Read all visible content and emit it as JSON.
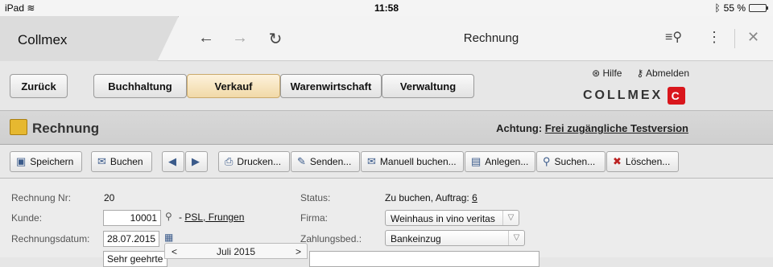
{
  "status_bar": {
    "device": "iPad",
    "wifi_icon": "wifi-icon",
    "time": "11:58",
    "bluetooth_icon": "bluetooth-icon",
    "battery": "55 %",
    "battery_level": 0.55
  },
  "browser": {
    "tab_title": "Collmex",
    "page_title": "Rechnung",
    "back_icon": "arrow-left-icon",
    "forward_icon": "arrow-right-icon",
    "reload_icon": "reload-icon",
    "search_icon": "search-list-icon",
    "menu_icon": "more-vertical-icon",
    "close_icon": "close-icon"
  },
  "app": {
    "back_label": "Zurück",
    "nav": [
      {
        "label": "Buchhaltung",
        "active": false
      },
      {
        "label": "Verkauf",
        "active": true
      },
      {
        "label": "Warenwirtschaft",
        "active": false
      },
      {
        "label": "Verwaltung",
        "active": false
      }
    ],
    "help_label": "Hilfe",
    "logout_label": "Abmelden",
    "logo_text": "COLLMEX"
  },
  "page": {
    "title": "Rechnung",
    "notice_prefix": "Achtung:",
    "notice_link": "Frei zugängliche Testversion"
  },
  "toolbar": [
    {
      "label": "Speichern",
      "icon": "save-icon"
    },
    {
      "label": "Buchen",
      "icon": "post-icon"
    },
    {
      "label": "",
      "icon": "arrow-left-icon"
    },
    {
      "label": "",
      "icon": "arrow-right-icon"
    },
    {
      "label": "Drucken...",
      "icon": "print-icon"
    },
    {
      "label": "Senden...",
      "icon": "send-icon"
    },
    {
      "label": "Manuell buchen...",
      "icon": "manual-post-icon"
    },
    {
      "label": "Anlegen...",
      "icon": "new-document-icon"
    },
    {
      "label": "Suchen...",
      "icon": "search-icon"
    },
    {
      "label": "Löschen...",
      "icon": "delete-icon"
    }
  ],
  "form": {
    "rechnung_nr_label": "Rechnung Nr:",
    "rechnung_nr": "20",
    "kunde_label": "Kunde:",
    "kunde_value": "10001",
    "kunde_link": "PSL, Frungen",
    "kunde_separator": "-",
    "rechnungsdatum_label": "Rechnungsdatum:",
    "rechnungsdatum_value": "28.07.2015",
    "anrede_value": "Sehr geehrte",
    "status_label": "Status:",
    "status_value": "Zu buchen, Auftrag:",
    "auftrag_link": "6",
    "firma_label": "Firma:",
    "firma_value": "Weinhaus in vino veritas",
    "zahlungsbed_label": "Zahlungsbed.:",
    "zahlungsbed_value": "Bankeinzug"
  },
  "calendar": {
    "prev": "<",
    "month": "Juli 2015",
    "next": ">"
  }
}
